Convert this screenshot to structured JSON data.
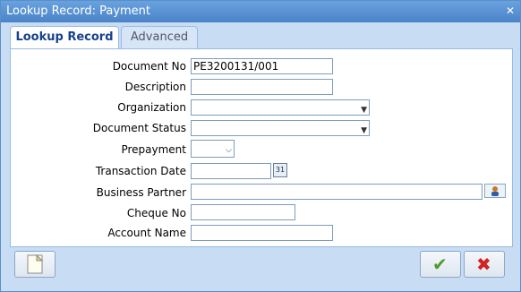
{
  "window": {
    "title": "Lookup Record: Payment",
    "close_glyph": "✕"
  },
  "tabs": [
    {
      "label": "Lookup Record"
    },
    {
      "label": "Advanced"
    }
  ],
  "form": {
    "document_no": {
      "label": "Document No",
      "value": "PE3200131/001"
    },
    "description": {
      "label": "Description",
      "value": ""
    },
    "organization": {
      "label": "Organization",
      "value": ""
    },
    "document_status": {
      "label": "Document Status",
      "value": ""
    },
    "prepayment": {
      "label": "Prepayment",
      "value": ""
    },
    "transaction_date": {
      "label": "Transaction Date",
      "value": ""
    },
    "business_partner": {
      "label": "Business Partner",
      "value": ""
    },
    "cheque_no": {
      "label": "Cheque No",
      "value": ""
    },
    "account_name": {
      "label": "Account Name",
      "value": ""
    }
  },
  "icons": {
    "calendar_text": "31",
    "ok_glyph": "✔",
    "cancel_glyph": "✖"
  }
}
